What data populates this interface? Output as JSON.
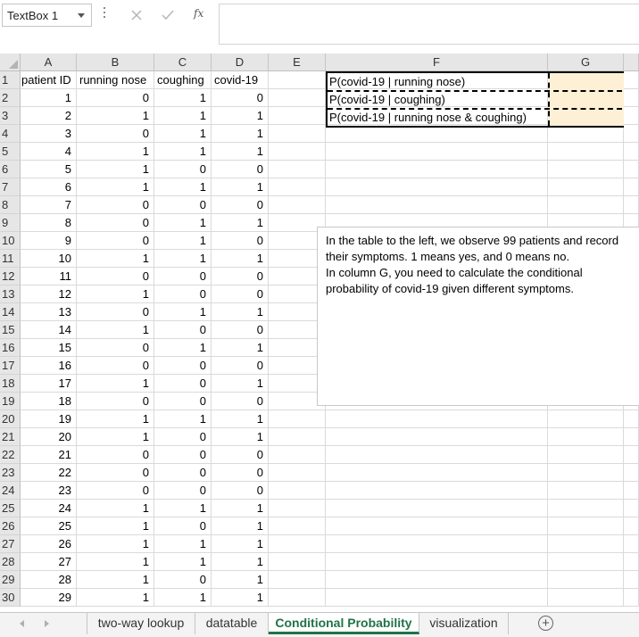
{
  "formula_bar": {
    "name_box": "TextBox 1",
    "fx_label": "fx",
    "formula": ""
  },
  "columns": [
    "A",
    "B",
    "C",
    "D",
    "E",
    "F",
    "G"
  ],
  "headers": {
    "A": "patient ID",
    "B": "running nose",
    "C": "coughing",
    "D": "covid-19"
  },
  "rows": [
    [
      1,
      0,
      1,
      0
    ],
    [
      2,
      1,
      1,
      1
    ],
    [
      3,
      0,
      1,
      1
    ],
    [
      4,
      1,
      1,
      1
    ],
    [
      5,
      1,
      0,
      0
    ],
    [
      6,
      1,
      1,
      1
    ],
    [
      7,
      0,
      0,
      0
    ],
    [
      8,
      0,
      1,
      1
    ],
    [
      9,
      0,
      1,
      0
    ],
    [
      10,
      1,
      1,
      1
    ],
    [
      11,
      0,
      0,
      0
    ],
    [
      12,
      1,
      0,
      0
    ],
    [
      13,
      0,
      1,
      1
    ],
    [
      14,
      1,
      0,
      0
    ],
    [
      15,
      0,
      1,
      1
    ],
    [
      16,
      0,
      0,
      0
    ],
    [
      17,
      1,
      0,
      1
    ],
    [
      18,
      0,
      0,
      0
    ],
    [
      19,
      1,
      1,
      1
    ],
    [
      20,
      1,
      0,
      1
    ],
    [
      21,
      0,
      0,
      0
    ],
    [
      22,
      0,
      0,
      0
    ],
    [
      23,
      0,
      0,
      0
    ],
    [
      24,
      1,
      1,
      1
    ],
    [
      25,
      1,
      0,
      1
    ],
    [
      26,
      1,
      1,
      1
    ],
    [
      27,
      1,
      1,
      1
    ],
    [
      28,
      1,
      0,
      1
    ],
    [
      29,
      1,
      1,
      1
    ]
  ],
  "row_numbers": [
    "1",
    "2",
    "3",
    "4",
    "5",
    "6",
    "7",
    "8",
    "9",
    "10",
    "11",
    "12",
    "13",
    "14",
    "15",
    "16",
    "17",
    "18",
    "19",
    "20",
    "21",
    "22",
    "23",
    "24",
    "25",
    "26",
    "27",
    "28",
    "29",
    "30"
  ],
  "probability_labels": [
    "P(covid-19 | running nose)",
    "P(covid-19 | coughing)",
    "P(covid-19 | running nose & coughing)"
  ],
  "textbox": {
    "paragraphs": [
      "In the table to the left, we observe 99 patients and record their symptoms. 1 means yes, and 0 means no.",
      "In column G, you need to calculate the conditional probability of covid-19 given different symptoms."
    ]
  },
  "sheet_tabs": [
    {
      "label": "two-way lookup",
      "active": false
    },
    {
      "label": "datatable",
      "active": false
    },
    {
      "label": "Conditional Probability",
      "active": true
    },
    {
      "label": "visualization",
      "active": false
    }
  ],
  "colors": {
    "accent": "#217346",
    "g_fill": "#fdf0d5"
  }
}
